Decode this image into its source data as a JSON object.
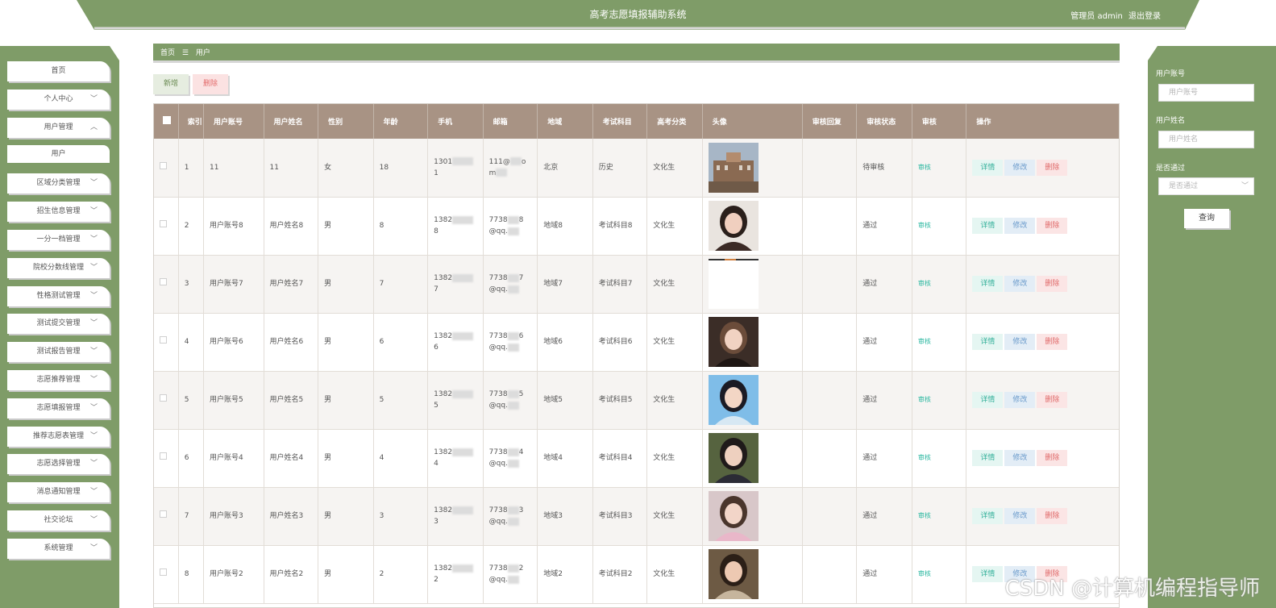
{
  "header": {
    "title": "高考志愿填报辅助系统",
    "role_label": "管理员 admin",
    "logout_label": "退出登录"
  },
  "sidebar": {
    "items": [
      {
        "label": "首页",
        "chevron": ""
      },
      {
        "label": "个人中心",
        "chevron": "﹀"
      },
      {
        "label": "用户管理",
        "chevron": "︿"
      },
      {
        "label": "用户",
        "chevron": "",
        "sub": true
      },
      {
        "label": "区域分类管理",
        "chevron": "﹀"
      },
      {
        "label": "招生信息管理",
        "chevron": "﹀"
      },
      {
        "label": "一分一档管理",
        "chevron": "﹀"
      },
      {
        "label": "院校分数线管理",
        "chevron": "﹀"
      },
      {
        "label": "性格测试管理",
        "chevron": "﹀"
      },
      {
        "label": "测试提交管理",
        "chevron": "﹀"
      },
      {
        "label": "测试报告管理",
        "chevron": "﹀"
      },
      {
        "label": "志愿推荐管理",
        "chevron": "﹀"
      },
      {
        "label": "志愿填报管理",
        "chevron": "﹀"
      },
      {
        "label": "推荐志愿表管理",
        "chevron": "﹀"
      },
      {
        "label": "志愿选择管理",
        "chevron": "﹀"
      },
      {
        "label": "消息通知管理",
        "chevron": "﹀"
      },
      {
        "label": "社交论坛",
        "chevron": "﹀"
      },
      {
        "label": "系统管理",
        "chevron": "﹀"
      }
    ]
  },
  "breadcrumb": {
    "home": "首页",
    "separator": "☰",
    "current": "用户"
  },
  "actions": {
    "add": "新增",
    "delete": "删除"
  },
  "table": {
    "headers": [
      "",
      "索引",
      "用户账号",
      "用户姓名",
      "性别",
      "年龄",
      "手机",
      "邮箱",
      "地域",
      "考试科目",
      "高考分类",
      "头像",
      "审核回复",
      "审核状态",
      "审核",
      "操作"
    ],
    "rows": [
      {
        "idx": "1",
        "account": "11",
        "name": "11",
        "gender": "女",
        "age": "18",
        "phone_a": "1301",
        "phone_b": "1",
        "email_a": "111@",
        "email_a2": "o",
        "email_b": "m",
        "region": "北京",
        "subject": "历史",
        "category": "文化生",
        "reply": "",
        "status": "待审核",
        "audit": "审核",
        "avatar": "campus"
      },
      {
        "idx": "2",
        "account": "用户账号8",
        "name": "用户姓名8",
        "gender": "男",
        "age": "8",
        "phone_a": "1382",
        "phone_b": "8",
        "email_a": "7738",
        "email_a2": "8",
        "email_b": "@qq.",
        "region": "地域8",
        "subject": "考试科目8",
        "category": "文化生",
        "reply": "",
        "status": "通过",
        "audit": "审核",
        "avatar": "girl-dark"
      },
      {
        "idx": "3",
        "account": "用户账号7",
        "name": "用户姓名7",
        "gender": "男",
        "age": "7",
        "phone_a": "1382",
        "phone_b": "7",
        "email_a": "7738",
        "email_a2": "7",
        "email_b": "@qq.",
        "region": "地域7",
        "subject": "考试科目7",
        "category": "文化生",
        "reply": "",
        "status": "通过",
        "audit": "审核",
        "avatar": "empty"
      },
      {
        "idx": "4",
        "account": "用户账号6",
        "name": "用户姓名6",
        "gender": "男",
        "age": "6",
        "phone_a": "1382",
        "phone_b": "6",
        "email_a": "7738",
        "email_a2": "6",
        "email_b": "@qq.",
        "region": "地域6",
        "subject": "考试科目6",
        "category": "文化生",
        "reply": "",
        "status": "通过",
        "audit": "审核",
        "avatar": "girl-warm"
      },
      {
        "idx": "5",
        "account": "用户账号5",
        "name": "用户姓名5",
        "gender": "男",
        "age": "5",
        "phone_a": "1382",
        "phone_b": "5",
        "email_a": "7738",
        "email_a2": "5",
        "email_b": "@qq.",
        "region": "地域5",
        "subject": "考试科目5",
        "category": "文化生",
        "reply": "",
        "status": "通过",
        "audit": "审核",
        "avatar": "boy-blue"
      },
      {
        "idx": "6",
        "account": "用户账号4",
        "name": "用户姓名4",
        "gender": "男",
        "age": "4",
        "phone_a": "1382",
        "phone_b": "4",
        "email_a": "7738",
        "email_a2": "4",
        "email_b": "@qq.",
        "region": "地域4",
        "subject": "考试科目4",
        "category": "文化生",
        "reply": "",
        "status": "通过",
        "audit": "审核",
        "avatar": "girl-green"
      },
      {
        "idx": "7",
        "account": "用户账号3",
        "name": "用户姓名3",
        "gender": "男",
        "age": "3",
        "phone_a": "1382",
        "phone_b": "3",
        "email_a": "7738",
        "email_a2": "3",
        "email_b": "@qq.",
        "region": "地域3",
        "subject": "考试科目3",
        "category": "文化生",
        "reply": "",
        "status": "通过",
        "audit": "审核",
        "avatar": "girl-pink"
      },
      {
        "idx": "8",
        "account": "用户账号2",
        "name": "用户姓名2",
        "gender": "男",
        "age": "2",
        "phone_a": "1382",
        "phone_b": "2",
        "email_a": "7738",
        "email_a2": "2",
        "email_b": "@qq.",
        "region": "地域2",
        "subject": "考试科目2",
        "category": "文化生",
        "reply": "",
        "status": "通过",
        "audit": "审核",
        "avatar": "girl-sun"
      }
    ],
    "ops": {
      "detail": "详情",
      "edit": "修改",
      "delete": "删除"
    }
  },
  "search": {
    "account_label": "用户账号",
    "account_placeholder": "用户账号",
    "name_label": "用户姓名",
    "name_placeholder": "用户姓名",
    "pass_label": "是否通过",
    "pass_placeholder": "是否通过",
    "query_button": "查询"
  },
  "watermark": "CSDN @计算机编程指导师",
  "colors": {
    "primary_green": "#7f9c68",
    "table_header": "#a89384"
  }
}
